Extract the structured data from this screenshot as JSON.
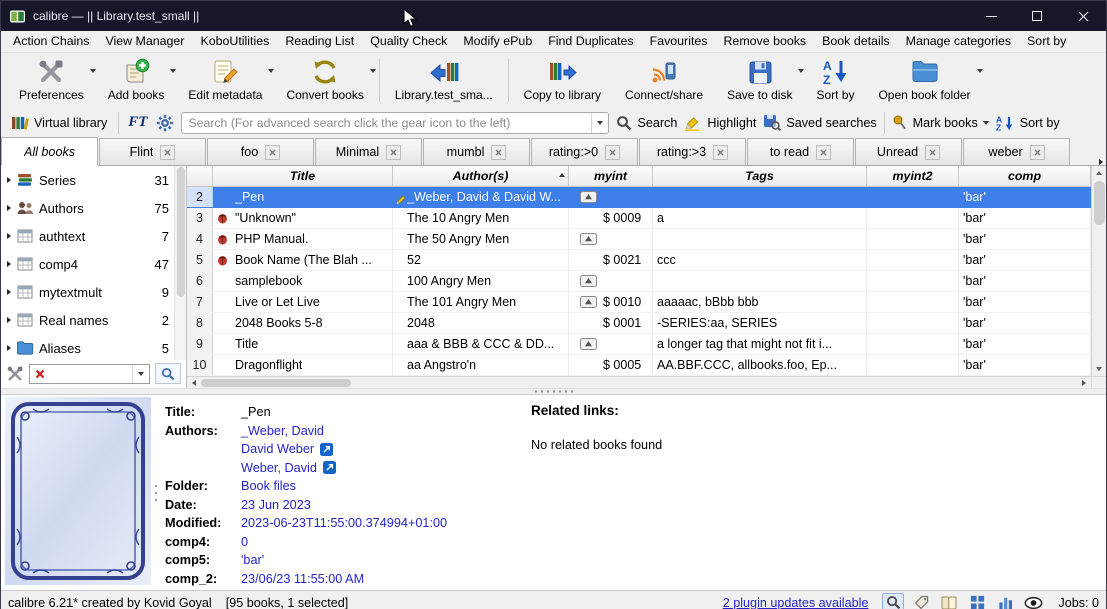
{
  "window": {
    "title": "calibre — || Library.test_small ||"
  },
  "menubar": {
    "items": [
      "Action Chains",
      "View Manager",
      "KoboUtilities",
      "Reading List",
      "Quality Check",
      "Modify ePub",
      "Find Duplicates",
      "Favourites",
      "Remove books",
      "Book details",
      "Manage categories",
      "Sort by"
    ]
  },
  "toolbar": {
    "buttons": [
      {
        "label": "Preferences",
        "icon": "preferences-tools-icon"
      },
      {
        "label": "Add books",
        "icon": "add-books-icon"
      },
      {
        "label": "Edit metadata",
        "icon": "edit-metadata-icon"
      },
      {
        "label": "Convert books",
        "icon": "convert-books-icon"
      },
      {
        "label": "Library.test_sma...",
        "icon": "choose-library-icon"
      },
      {
        "label": "Copy to library",
        "icon": "copy-to-library-icon"
      },
      {
        "label": "Connect/share",
        "icon": "connect-share-icon"
      },
      {
        "label": "Save to disk",
        "icon": "save-to-disk-icon"
      },
      {
        "label": "Sort by",
        "icon": "sort-az-icon"
      },
      {
        "label": "Open book folder",
        "icon": "book-folder-icon"
      }
    ]
  },
  "search": {
    "virtual_library": "Virtual library",
    "ft_label": "FT",
    "placeholder": "Search (For advanced search click the gear icon to the left)",
    "search_label": "Search",
    "highlight_label": "Highlight",
    "saved_searches_label": "Saved searches",
    "mark_books_label": "Mark books",
    "sort_by_label": "Sort by"
  },
  "tabs": {
    "all_books": "All books",
    "items": [
      "Flint",
      "foo",
      "Minimal",
      "mumbl",
      "rating:>0",
      "rating:>3",
      "to read",
      "Unread",
      "weber"
    ]
  },
  "sidebar": {
    "items": [
      {
        "label": "Series",
        "count": "31",
        "icon": "series-icon"
      },
      {
        "label": "Authors",
        "count": "75",
        "icon": "authors-icon"
      },
      {
        "label": "authtext",
        "count": "7",
        "icon": "column-icon"
      },
      {
        "label": "comp4",
        "count": "47",
        "icon": "column-icon"
      },
      {
        "label": "mytextmult",
        "count": "9",
        "icon": "column-icon"
      },
      {
        "label": "Real names",
        "count": "2",
        "icon": "column-icon"
      },
      {
        "label": "Aliases",
        "count": "5",
        "icon": "folder-icon"
      }
    ]
  },
  "table": {
    "columns": [
      "Title",
      "Author(s)",
      "myint",
      "Tags",
      "myint2",
      "comp"
    ],
    "rows": [
      {
        "num": "2",
        "title": "_Pen",
        "authors": "_Weber, David & David W...",
        "myint": "",
        "tags": "",
        "myint2": "",
        "comp": "'bar'"
      },
      {
        "num": "3",
        "title": "\"Unknown\"",
        "authors": "The 10 Angry Men",
        "myint": "$ 0009",
        "tags": "a",
        "myint2": "",
        "comp": "'bar'"
      },
      {
        "num": "4",
        "title": "PHP Manual.",
        "authors": "The 50 Angry Men",
        "myint": "",
        "tags": "",
        "myint2": "",
        "comp": "'bar'"
      },
      {
        "num": "5",
        "title": "Book Name (The Blah ...",
        "authors": "52",
        "myint": "$ 0021",
        "tags": "ccc",
        "myint2": "",
        "comp": "'bar'"
      },
      {
        "num": "6",
        "title": "samplebook",
        "authors": "100 Angry Men",
        "myint": "",
        "tags": "",
        "myint2": "",
        "comp": "'bar'"
      },
      {
        "num": "7",
        "title": "Live or Let Live",
        "authors": "The 101 Angry Men",
        "myint": "$ 0010",
        "tags": "aaaaac, bBbb bbb",
        "myint2": "",
        "comp": "'bar'"
      },
      {
        "num": "8",
        "title": "2048 Books 5-8",
        "authors": "2048",
        "myint": "$ 0001",
        "tags": "-SERIES:aa, SERIES",
        "myint2": "",
        "comp": "'bar'"
      },
      {
        "num": "9",
        "title": "Title",
        "authors": "aaa & BBB & CCC & DD...",
        "myint": "",
        "tags": "a longer tag that might not fit i...",
        "myint2": "",
        "comp": "'bar'"
      },
      {
        "num": "10",
        "title": "Dragonflight",
        "authors": "aa Angstro'n",
        "myint": "$ 0005",
        "tags": "AA.BBF.CCC, allbooks.foo, Ep...",
        "myint2": "",
        "comp": "'bar'"
      }
    ]
  },
  "details": {
    "title_label": "Title:",
    "title": "_Pen",
    "authors_label": "Authors:",
    "authors": [
      "_Weber, David",
      "David Weber",
      "Weber, David"
    ],
    "folder_label": "Folder:",
    "folder": "Book files",
    "date_label": "Date:",
    "date": "23 Jun 2023",
    "modified_label": "Modified:",
    "modified": "2023-06-23T11:55:00.374994+01:00",
    "comp4_label": "comp4:",
    "comp4": "0",
    "comp5_label": "comp5:",
    "comp5": "'bar'",
    "comp_2_label": "comp_2:",
    "comp_2": "23/06/23 11:55:00 AM",
    "related_title": "Related links:",
    "related_text": "No related books found"
  },
  "statusbar": {
    "version": "calibre 6.21* created by Kovid Goyal",
    "books": "[95 books, 1 selected]",
    "plugin_updates": "2 plugin updates available",
    "jobs": "Jobs: 0"
  }
}
